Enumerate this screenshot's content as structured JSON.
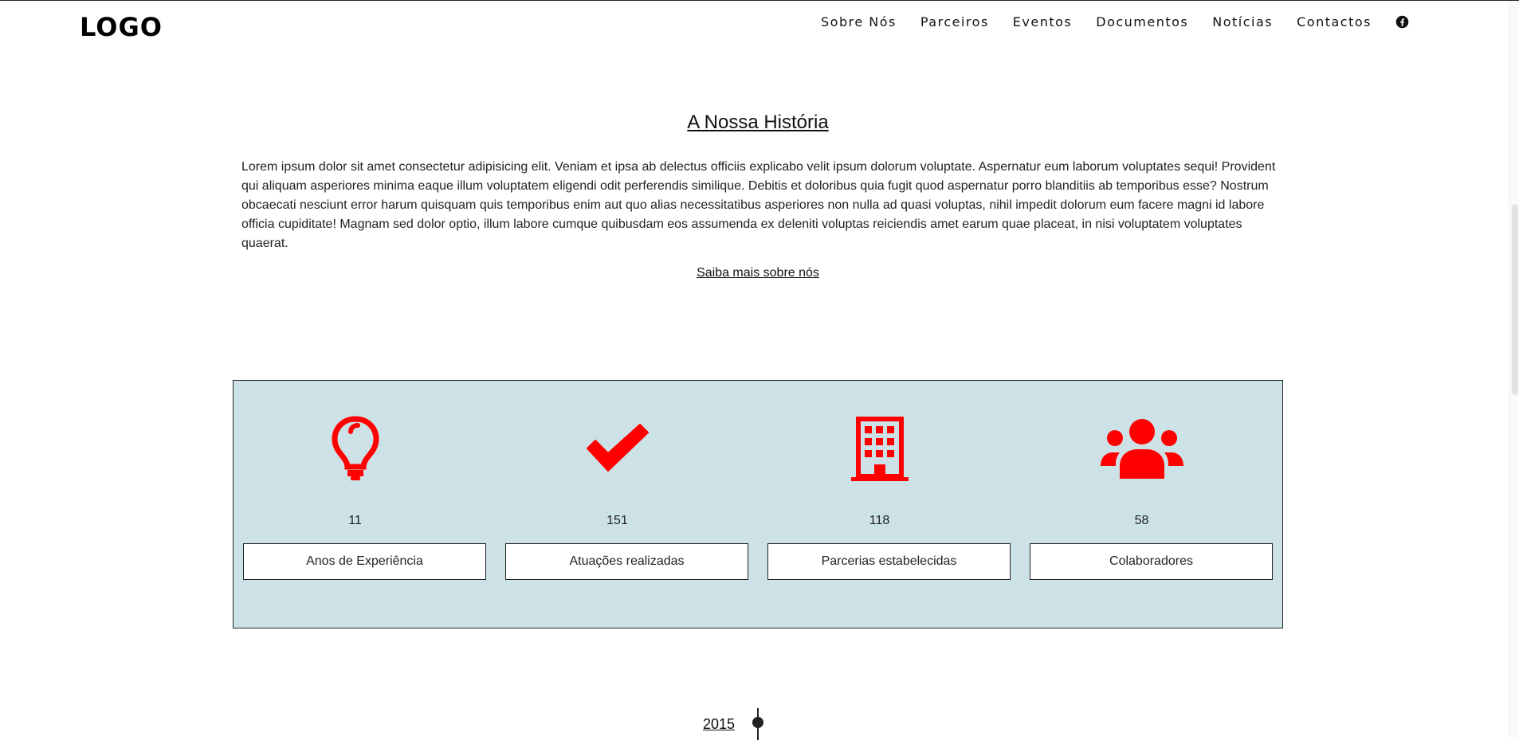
{
  "header": {
    "logo": "LOGO",
    "nav": [
      "Sobre Nós",
      "Parceiros",
      "Eventos",
      "Documentos",
      "Notícias",
      "Contactos"
    ],
    "social_icon": "facebook-icon"
  },
  "history": {
    "title": "A Nossa História",
    "body": "Lorem ipsum dolor sit amet consectetur adipisicing elit. Veniam et ipsa ab delectus officiis explicabo velit ipsum dolorum voluptate. Aspernatur eum laborum voluptates sequi! Provident qui aliquam asperiores minima eaque illum voluptatem eligendi odit perferendis similique. Debitis et doloribus quia fugit quod aspernatur porro blanditiis ab temporibus esse? Nostrum obcaecati nesciunt error harum quisquam quis temporibus enim aut quo alias necessitatibus asperiores non nulla ad quasi voluptas, nihil impedit dolorum eum facere magni id labore officia cupiditate! Magnam sed dolor optio, illum labore cumque quibusdam eos assumenda ex deleniti voluptas reiciendis amet earum quae placeat, in nisi voluptatem voluptates quaerat.",
    "link": "Saiba mais sobre nós"
  },
  "stats": {
    "accent_color": "#ff0000",
    "background_color": "#cce2e6",
    "items": [
      {
        "icon": "lightbulb-icon",
        "count": "11",
        "label": "Anos de Experiência"
      },
      {
        "icon": "check-icon",
        "count": "151",
        "label": "Atuações realizadas"
      },
      {
        "icon": "building-icon",
        "count": "118",
        "label": "Parcerias estabelecidas"
      },
      {
        "icon": "users-icon",
        "count": "58",
        "label": "Colaboradores"
      }
    ]
  },
  "timeline": {
    "first_year": "2015"
  }
}
